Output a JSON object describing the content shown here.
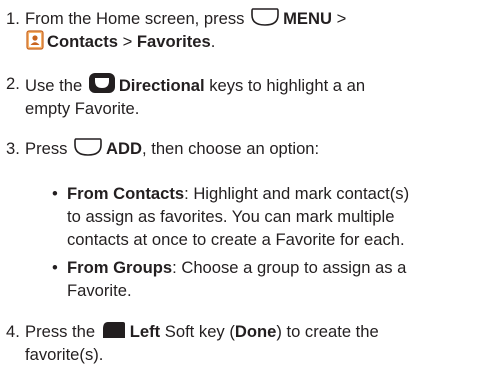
{
  "steps": [
    {
      "num": "1.",
      "pre": "From the Home screen, press",
      "menu": "MENU",
      "sep1": " >",
      "contacts": "Contacts",
      "sep2": " > ",
      "favorites": "Favorites",
      "end": "."
    },
    {
      "num": "2.",
      "pre": "Use the",
      "directional": "Directional",
      "post": " keys to highlight a an",
      "post2": "empty Favorite."
    },
    {
      "num": "3.",
      "pre": "Press",
      "add": "ADD",
      "post": ", then choose an option:"
    },
    {
      "num": "4.",
      "pre": "Press the",
      "left": "Left",
      "mid": " Soft key (",
      "done": "Done",
      "post": ") to create the",
      "post2": "favorite(s)."
    }
  ],
  "options": [
    {
      "bullet": "•",
      "title": "From Contacts",
      "l1": ": Highlight and mark contact(s)",
      "l2": "to assign as favorites. You can mark multiple",
      "l3": "contacts at once to create a Favorite for each."
    },
    {
      "bullet": "•",
      "title": "From Groups",
      "l1": ": Choose a group to assign as a",
      "l2": "Favorite."
    }
  ],
  "icons": {
    "menu_key": "soft-key-icon",
    "contacts_app": "contacts-app-icon",
    "directional_key": "directional-key-icon",
    "add_key": "soft-key-icon",
    "left_soft_key": "left-soft-key-icon"
  },
  "colors": {
    "text": "#231f20",
    "key_outline": "#231f20",
    "contacts_icon": "#e07b2b"
  }
}
